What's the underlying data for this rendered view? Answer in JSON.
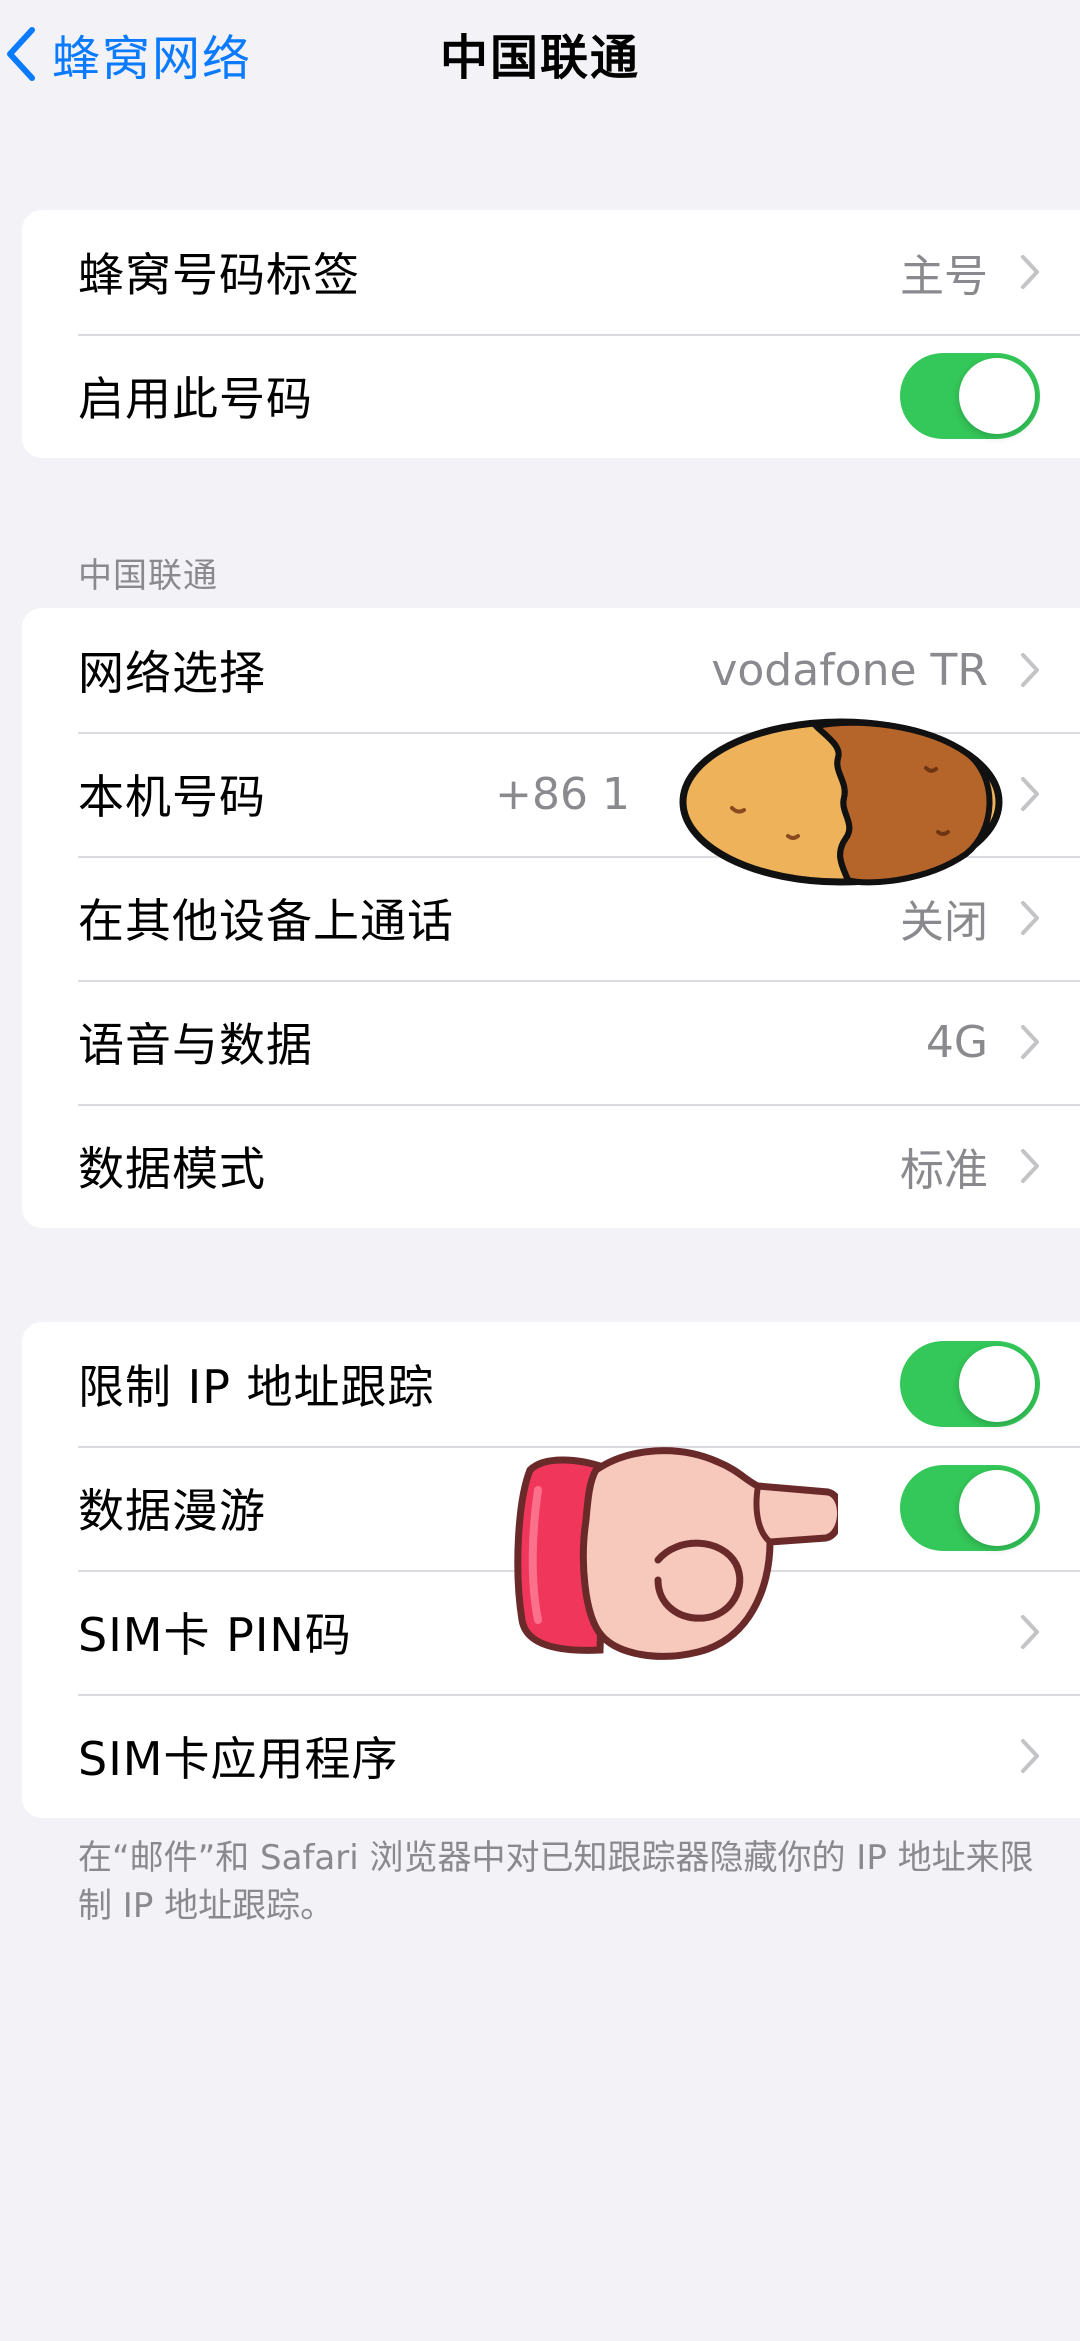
{
  "nav": {
    "back_label": "蜂窝网络",
    "title": "中国联通"
  },
  "group1": {
    "rows": [
      {
        "label": "蜂窝号码标签",
        "value": "主号"
      },
      {
        "label": "启用此号码",
        "toggle": true
      }
    ]
  },
  "section_header": "中国联通",
  "group2": {
    "rows": [
      {
        "label": "网络选择",
        "value": "vodafone TR"
      },
      {
        "label": "本机号码",
        "value": "+86 1"
      },
      {
        "label": "在其他设备上通话",
        "value": "关闭"
      },
      {
        "label": "语音与数据",
        "value": "4G"
      },
      {
        "label": "数据模式",
        "value": "标准"
      }
    ]
  },
  "group3": {
    "rows": [
      {
        "label": "限制 IP 地址跟踪",
        "toggle": true
      },
      {
        "label": "数据漫游",
        "toggle": true
      },
      {
        "label": "SIM卡 PIN码"
      },
      {
        "label": "SIM卡应用程序"
      }
    ]
  },
  "footer_text": "在“邮件”和 Safari 浏览器中对已知跟踪器隐藏你的 IP 地址来限制 IP 地址跟踪。",
  "colors": {
    "accent": "#0a7aff",
    "toggle_on": "#34c759",
    "background": "#f2f2f7"
  },
  "icons": {
    "back": "chevron-left-icon",
    "row": "chevron-right-icon",
    "potato": "potato-sticker",
    "pointer": "pointing-hand-sticker"
  }
}
